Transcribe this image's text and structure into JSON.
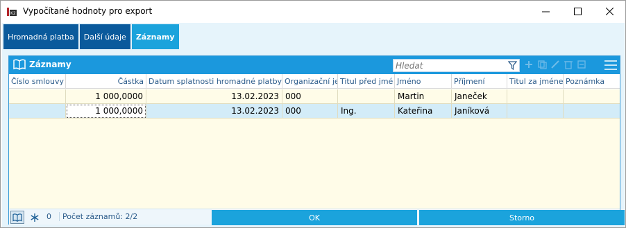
{
  "window": {
    "title": "Vypočítané hodnoty pro export"
  },
  "tabs": [
    {
      "label": "Hromadná platba"
    },
    {
      "label": "Další údaje"
    },
    {
      "label": "Záznamy"
    }
  ],
  "panel": {
    "title": "Záznamy",
    "search_placeholder": "Hledat"
  },
  "grid": {
    "columns": [
      "Číslo smlouvy",
      "Částka",
      "Datum splatnosti hromadné platby",
      "Organizační je",
      "Titul před jmé",
      "Jméno",
      "Příjmení",
      "Titul za jménem",
      "Poznámka"
    ],
    "rows": [
      [
        "",
        "1 000,0000",
        "13.02.2023",
        "000",
        "",
        "Martin",
        "Janeček",
        "",
        ""
      ],
      [
        "",
        "1 000,0000",
        "13.02.2023",
        "000",
        "Ing.",
        "Kateřina",
        "Janíková",
        "",
        ""
      ]
    ]
  },
  "status": {
    "count_badge": "0",
    "records_label": "Počet záznamů: 2/2"
  },
  "buttons": {
    "ok": "OK",
    "cancel": "Storno"
  },
  "colors": {
    "header_blue": "#1b98dd",
    "tab_dark": "#0a5a9c",
    "tab_active": "#1ba3dc",
    "row_yellow": "#fffce8",
    "row_selected": "#d3ecf8"
  }
}
